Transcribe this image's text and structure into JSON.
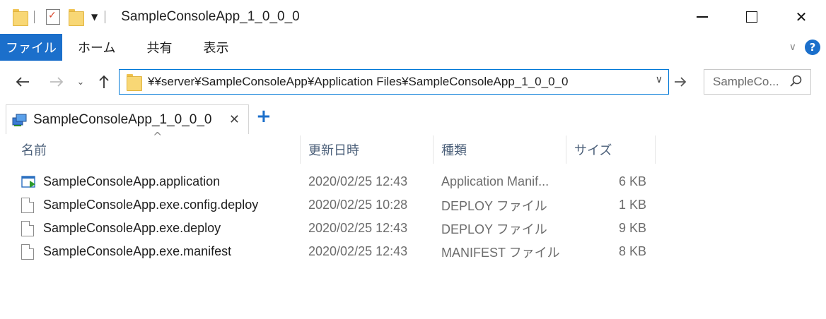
{
  "window": {
    "title": "SampleConsoleApp_1_0_0_0",
    "close_glyph": "✕"
  },
  "ribbon": {
    "tabs": [
      "ファイル",
      "ホーム",
      "共有",
      "表示"
    ],
    "help_glyph": "?"
  },
  "nav": {
    "address": "¥¥server¥SampleConsoleApp¥Application Files¥SampleConsoleApp_1_0_0_0",
    "search_placeholder": "SampleCo..."
  },
  "tabs": {
    "active_label": "SampleConsoleApp_1_0_0_0",
    "close_glyph": "✕",
    "add_glyph": "+"
  },
  "columns": {
    "name": "名前",
    "date": "更新日時",
    "type": "種類",
    "size": "サイズ"
  },
  "files": [
    {
      "name": "SampleConsoleApp.application",
      "date": "2020/02/25 12:43",
      "type": "Application Manif...",
      "size": "6 KB",
      "icon": "application-manifest-icon"
    },
    {
      "name": "SampleConsoleApp.exe.config.deploy",
      "date": "2020/02/25 10:28",
      "type": "DEPLOY ファイル",
      "size": "1 KB",
      "icon": "file-icon"
    },
    {
      "name": "SampleConsoleApp.exe.deploy",
      "date": "2020/02/25 12:43",
      "type": "DEPLOY ファイル",
      "size": "9 KB",
      "icon": "file-icon"
    },
    {
      "name": "SampleConsoleApp.exe.manifest",
      "date": "2020/02/25 12:43",
      "type": "MANIFEST ファイル",
      "size": "8 KB",
      "icon": "file-icon"
    }
  ],
  "colors": {
    "accent": "#1b6fcb",
    "address_border": "#0078d7",
    "folder": "#f8d775"
  }
}
